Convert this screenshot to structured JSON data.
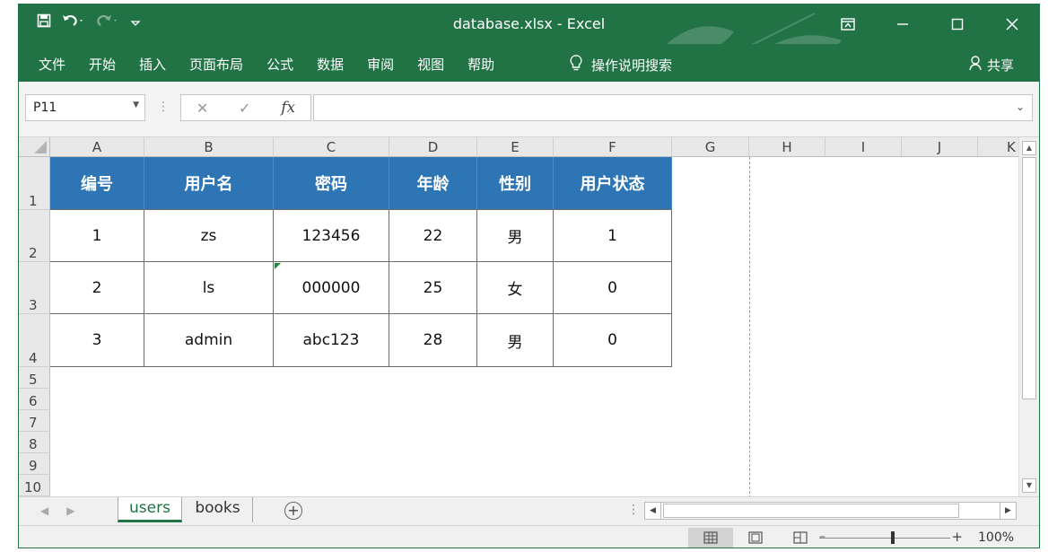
{
  "window": {
    "title": "database.xlsx  -  Excel"
  },
  "ribbon": {
    "tabs": [
      "文件",
      "开始",
      "插入",
      "页面布局",
      "公式",
      "数据",
      "审阅",
      "视图",
      "帮助"
    ],
    "tell_me": "操作说明搜索",
    "share": "共享"
  },
  "formula_bar": {
    "name_box": "P11",
    "fx": "fx",
    "content": ""
  },
  "columns": [
    "A",
    "B",
    "C",
    "D",
    "E",
    "F",
    "G",
    "H",
    "I",
    "J",
    "K"
  ],
  "rows": [
    "1",
    "2",
    "3",
    "4",
    "5",
    "6",
    "7",
    "8",
    "9",
    "10"
  ],
  "table": {
    "headers": [
      "编号",
      "用户名",
      "密码",
      "年龄",
      "性别",
      "用户状态"
    ],
    "rows": [
      [
        "1",
        "zs",
        "123456",
        "22",
        "男",
        "1"
      ],
      [
        "2",
        "ls",
        "000000",
        "25",
        "女",
        "0"
      ],
      [
        "3",
        "admin",
        "abc123",
        "28",
        "男",
        "0"
      ]
    ]
  },
  "sheets": {
    "active": "users",
    "tabs": [
      "users",
      "books"
    ]
  },
  "status": {
    "zoom": "100%"
  },
  "colors": {
    "excel_green": "#217346",
    "header_blue": "#2e75b6"
  },
  "icons": [
    "save-icon",
    "undo-icon",
    "redo-icon",
    "customize-qat-icon",
    "ribbon-display-icon",
    "minimize-icon",
    "maximize-icon",
    "close-icon",
    "lightbulb-icon",
    "share-person-icon",
    "cancel-icon",
    "enter-icon",
    "add-sheet-icon",
    "normal-view-icon",
    "page-layout-icon",
    "page-break-icon"
  ]
}
